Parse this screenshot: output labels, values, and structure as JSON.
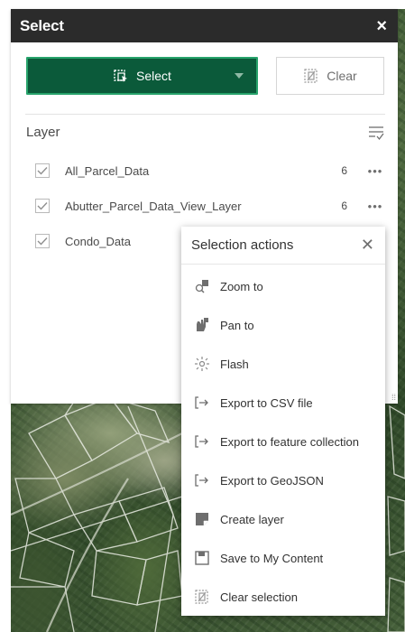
{
  "window": {
    "title": "Select",
    "close_glyph": "×"
  },
  "toolbar": {
    "select_label": "Select",
    "select_icon": "select-by-rectangle-icon",
    "clear_label": "Clear",
    "clear_icon": "clear-selection-icon",
    "accent_color": "#0b5a3a"
  },
  "layers": {
    "header": "Layer",
    "items": [
      {
        "name": "All_Parcel_Data",
        "count": "6",
        "checked": true
      },
      {
        "name": "Abutter_Parcel_Data_View_Layer",
        "count": "6",
        "checked": true
      },
      {
        "name": "Condo_Data",
        "count": "",
        "checked": true
      }
    ]
  },
  "actions_menu": {
    "title": "Selection actions",
    "items": [
      {
        "label": "Zoom to",
        "icon": "zoom-to-icon"
      },
      {
        "label": "Pan to",
        "icon": "pan-to-icon"
      },
      {
        "label": "Flash",
        "icon": "flash-icon"
      },
      {
        "label": "Export to CSV file",
        "icon": "export-icon"
      },
      {
        "label": "Export to feature collection",
        "icon": "export-icon"
      },
      {
        "label": "Export to GeoJSON",
        "icon": "export-icon"
      },
      {
        "label": "Create layer",
        "icon": "create-layer-icon"
      },
      {
        "label": "Save to My Content",
        "icon": "save-icon"
      },
      {
        "label": "Clear selection",
        "icon": "clear-selection-icon"
      }
    ]
  }
}
